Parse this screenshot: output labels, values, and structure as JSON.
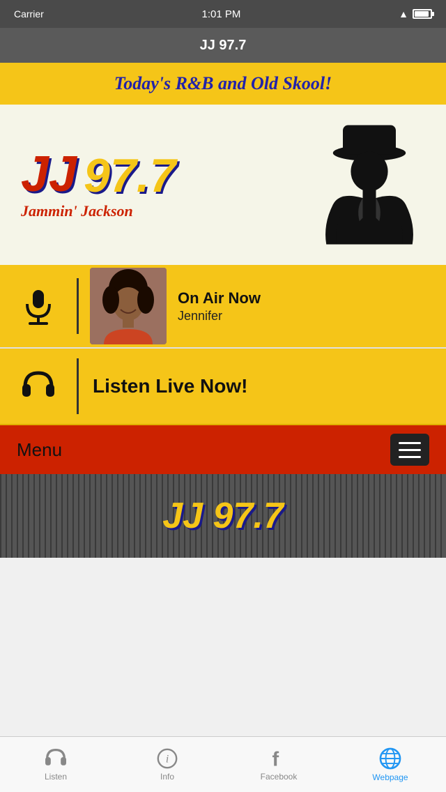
{
  "statusBar": {
    "carrier": "Carrier",
    "wifi": "WiFi",
    "time": "1:01 PM",
    "battery": "100%"
  },
  "navBar": {
    "title": "JJ 97.7"
  },
  "banner": {
    "text": "Today's R&B and Old Skool!"
  },
  "logo": {
    "jj": "JJ",
    "frequency": "97.7",
    "subtitle": "Jammin' Jackson"
  },
  "onAir": {
    "label": "On Air Now",
    "name": "Jennifer"
  },
  "listenLive": {
    "text": "Listen Live Now!"
  },
  "menu": {
    "label": "Menu"
  },
  "tabs": [
    {
      "id": "listen",
      "label": "Listen",
      "active": false
    },
    {
      "id": "info",
      "label": "Info",
      "active": false
    },
    {
      "id": "facebook",
      "label": "Facebook",
      "active": false
    },
    {
      "id": "webpage",
      "label": "Webpage",
      "active": true
    }
  ]
}
